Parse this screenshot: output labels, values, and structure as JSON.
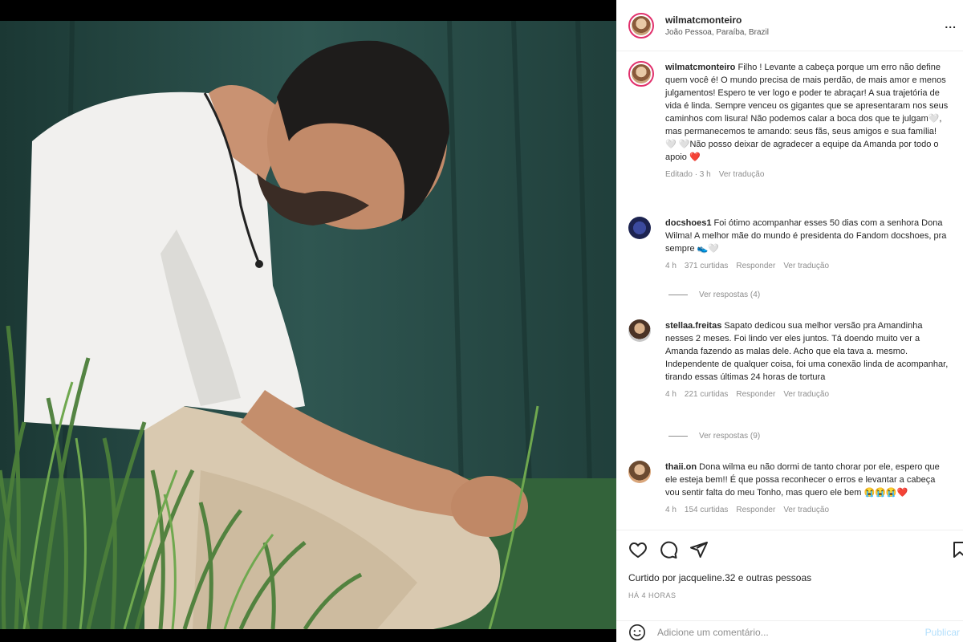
{
  "post": {
    "username": "wilmatcmonteiro",
    "location": "João Pessoa, Paraíba, Brazil",
    "more": "..."
  },
  "caption": {
    "username": "wilmatcmonteiro",
    "text": "Filho ! Levante a cabeça porque um erro não define quem você é! O mundo precisa de mais perdão, de mais amor e menos julgamentos! Espero te ver logo e poder te abraçar! A sua trajetória de vida é linda. Sempre venceu os gigantes que se apresentaram nos seus caminhos com lisura! Não podemos calar a boca dos que te julgam🤍, mas permanecemos te amando: seus fãs, seus amigos e sua família! 🤍 🤍Não posso deixar de agradecer a equipe da Amanda por todo o apoio ❤️",
    "edited": "Editado · 3 h",
    "translate": "Ver tradução"
  },
  "comments": [
    {
      "username": "docshoes1",
      "text": "Foi ótimo acompanhar esses 50 dias com a senhora Dona Wilma! A melhor mãe do mundo é presidenta do Fandom docshoes, pra sempre 👟🤍",
      "time": "4 h",
      "likes": "371 curtidas",
      "reply": "Responder",
      "translate": "Ver tradução",
      "view_replies": "Ver respostas (4)"
    },
    {
      "username": "stellaa.freitas",
      "text": "Sapato dedicou sua melhor versão pra Amandinha nesses 2 meses. Foi lindo ver eles juntos. Tá doendo muito ver a Amanda fazendo as malas dele. Acho que ela tava a. mesmo. Independente de qualquer coisa, foi uma conexão linda de acompanhar, tirando essas últimas 24 horas de tortura",
      "time": "4 h",
      "likes": "221 curtidas",
      "reply": "Responder",
      "translate": "Ver tradução",
      "view_replies": "Ver respostas (9)"
    },
    {
      "username": "thaii.on",
      "text": "Dona wilma eu não dormi de tanto chorar por ele, espero que ele esteja bem!! É que possa reconhecer o erros e levantar a cabeça vou sentir falta do meu Tonho, mas quero ele bem 😭😭😭❤️",
      "time": "4 h",
      "likes": "154 curtidas",
      "reply": "Responder",
      "translate": "Ver tradução"
    }
  ],
  "actions": {
    "liked_by": "Curtido por jacqueline.32 e outras pessoas",
    "timestamp": "HÁ 4 HORAS",
    "add_comment_placeholder": "Adicione um comentário...",
    "publish": "Publicar"
  },
  "colors": {
    "accent": "#0095f6",
    "heart": "#ed4956",
    "text": "#262626",
    "muted": "#8e8e8e"
  }
}
